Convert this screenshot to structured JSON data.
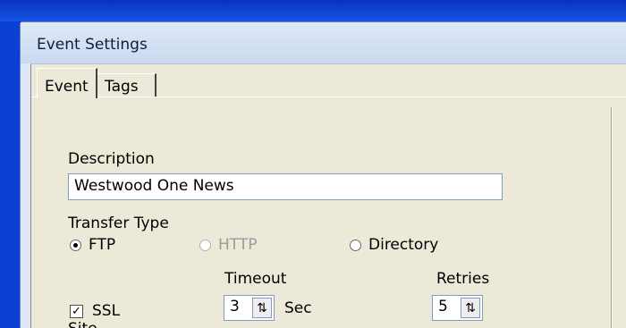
{
  "window": {
    "title": "Event Settings"
  },
  "tabs": [
    {
      "label": "Event",
      "active": true
    },
    {
      "label": "Tags",
      "active": false
    }
  ],
  "description": {
    "label": "Description",
    "value": "Westwood One News"
  },
  "transfer_type": {
    "label": "Transfer Type",
    "options": [
      {
        "label": "FTP",
        "selected": true,
        "enabled": true
      },
      {
        "label": "HTTP",
        "selected": false,
        "enabled": false
      },
      {
        "label": "Directory",
        "selected": false,
        "enabled": true
      }
    ]
  },
  "ssl": {
    "label": "SSL",
    "checked": true
  },
  "timeout": {
    "label": "Timeout",
    "value": "3",
    "unit": "Sec"
  },
  "retries": {
    "label": "Retries",
    "value": "5"
  },
  "site": {
    "label": "Site"
  },
  "icons": {
    "spin_up_down": "⇅",
    "check": "✓"
  }
}
